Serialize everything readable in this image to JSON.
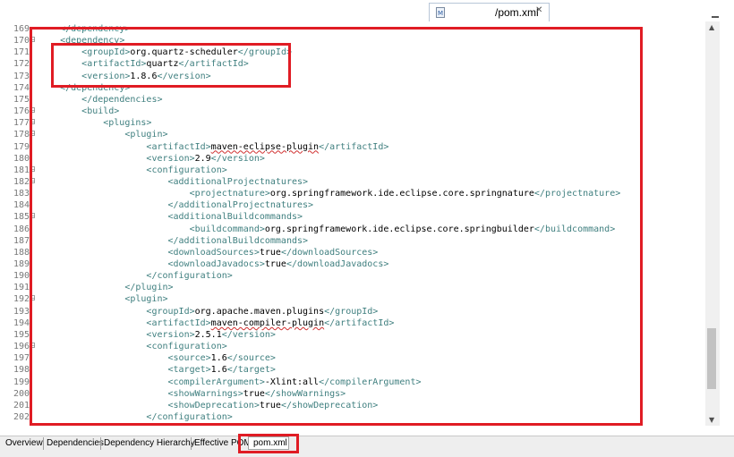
{
  "editor_tab": {
    "icon_label": "M",
    "title": "/pom.xml"
  },
  "bottom_tabs": [
    {
      "label": "Overview"
    },
    {
      "label": "Dependencies"
    },
    {
      "label": "Dependency Hierarchy"
    },
    {
      "label": "Effective POM"
    },
    {
      "label": "pom.xml",
      "active": true
    }
  ],
  "lines": [
    {
      "n": "169",
      "fold": false,
      "text": "    </dependency>"
    },
    {
      "n": "170",
      "fold": true,
      "text": "    <dependency>"
    },
    {
      "n": "171",
      "fold": false,
      "text": "        <groupId>org.quartz-scheduler</groupId>"
    },
    {
      "n": "172",
      "fold": false,
      "text": "        <artifactId>quartz</artifactId>"
    },
    {
      "n": "173",
      "fold": false,
      "text": "        <version>1.8.6</version>"
    },
    {
      "n": "174",
      "fold": false,
      "text": "    </dependency>"
    },
    {
      "n": "175",
      "fold": false,
      "text": "        </dependencies>"
    },
    {
      "n": "176",
      "fold": true,
      "text": "        <build>"
    },
    {
      "n": "177",
      "fold": true,
      "text": "            <plugins>"
    },
    {
      "n": "178",
      "fold": true,
      "text": "                <plugin>"
    },
    {
      "n": "179",
      "fold": false,
      "text": "                    <artifactId>maven-eclipse-plugin</artifactId>",
      "squiggle": "maven-eclipse-plugin"
    },
    {
      "n": "180",
      "fold": false,
      "text": "                    <version>2.9</version>"
    },
    {
      "n": "181",
      "fold": true,
      "text": "                    <configuration>"
    },
    {
      "n": "182",
      "fold": true,
      "text": "                        <additionalProjectnatures>"
    },
    {
      "n": "183",
      "fold": false,
      "text": "                            <projectnature>org.springframework.ide.eclipse.core.springnature</projectnature>"
    },
    {
      "n": "184",
      "fold": false,
      "text": "                        </additionalProjectnatures>"
    },
    {
      "n": "185",
      "fold": true,
      "text": "                        <additionalBuildcommands>"
    },
    {
      "n": "186",
      "fold": false,
      "text": "                            <buildcommand>org.springframework.ide.eclipse.core.springbuilder</buildcommand>"
    },
    {
      "n": "187",
      "fold": false,
      "text": "                        </additionalBuildcommands>"
    },
    {
      "n": "188",
      "fold": false,
      "text": "                        <downloadSources>true</downloadSources>"
    },
    {
      "n": "189",
      "fold": false,
      "text": "                        <downloadJavadocs>true</downloadJavadocs>"
    },
    {
      "n": "190",
      "fold": false,
      "text": "                    </configuration>"
    },
    {
      "n": "191",
      "fold": false,
      "text": "                </plugin>"
    },
    {
      "n": "192",
      "fold": true,
      "text": "                <plugin>"
    },
    {
      "n": "193",
      "fold": false,
      "text": "                    <groupId>org.apache.maven.plugins</groupId>"
    },
    {
      "n": "194",
      "fold": false,
      "text": "                    <artifactId>maven-compiler-plugin</artifactId>",
      "squiggle": "maven-compiler-plugin"
    },
    {
      "n": "195",
      "fold": false,
      "text": "                    <version>2.5.1</version>"
    },
    {
      "n": "196",
      "fold": true,
      "text": "                    <configuration>"
    },
    {
      "n": "197",
      "fold": false,
      "text": "                        <source>1.6</source>"
    },
    {
      "n": "198",
      "fold": false,
      "text": "                        <target>1.6</target>"
    },
    {
      "n": "199",
      "fold": false,
      "text": "                        <compilerArgument>-Xlint:all</compilerArgument>"
    },
    {
      "n": "200",
      "fold": false,
      "text": "                        <showWarnings>true</showWarnings>"
    },
    {
      "n": "201",
      "fold": false,
      "text": "                        <showDeprecation>true</showDeprecation>"
    },
    {
      "n": "202",
      "fold": false,
      "text": "                    </configuration>"
    }
  ],
  "colors": {
    "tag": "#3f7f7f",
    "text": "#000000",
    "highlight_box": "#e01c24",
    "line_number": "#787878"
  }
}
